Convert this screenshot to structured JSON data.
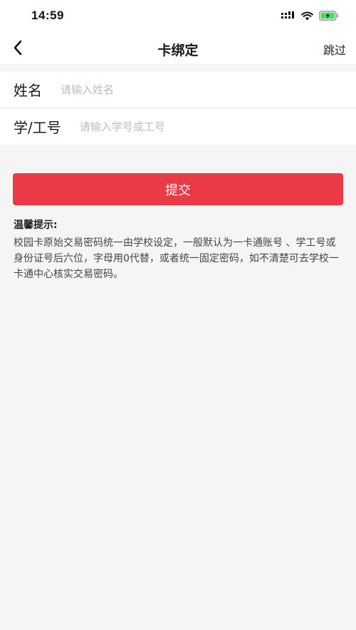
{
  "status_bar": {
    "time": "14:59",
    "icons": [
      "signal-icon",
      "wifi-icon",
      "battery-charging-icon"
    ]
  },
  "nav": {
    "back_icon": "chevron-left-icon",
    "title": "卡绑定",
    "skip_label": "跳过"
  },
  "form": {
    "name": {
      "label": "姓名",
      "value": "",
      "placeholder": "请输入姓名"
    },
    "id": {
      "label": "学/工号",
      "value": "",
      "placeholder": "请输入学号或工号"
    }
  },
  "submit_label": "提交",
  "tips": {
    "title": "温馨提示:",
    "body": "校园卡原始交易密码统一由学校设定，一般默认为一卡通账号 、学工号或身份证号后六位，字母用0代替，或者统一固定密码，如不清楚可去学校一卡通中心核实交易密码。"
  },
  "colors": {
    "accent": "#ea3a46",
    "background": "#f5f5f5",
    "battery_fill": "#4cd964"
  }
}
